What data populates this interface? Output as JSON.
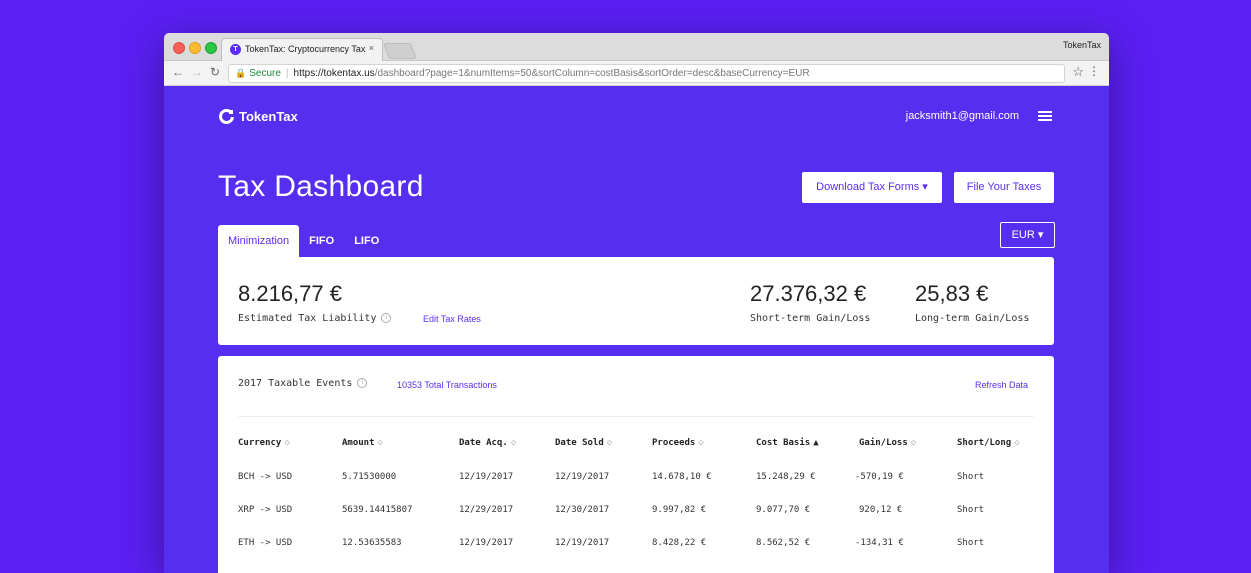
{
  "browser": {
    "tab_title": "TokenTax: Cryptocurrency Tax",
    "tab_close": "×",
    "profile": "TokenTax",
    "secure_label": "Secure",
    "url_host": "https://tokentax.us",
    "url_rest": "/dashboard?page=1&numItems=50&sortColumn=costBasis&sortOrder=desc&baseCurrency=EUR"
  },
  "header": {
    "logo_text": "TokenTax",
    "user_email": "jacksmith1@gmail.com"
  },
  "page": {
    "title": "Tax Dashboard",
    "download_label": "Download Tax Forms ▾",
    "file_label": "File Your Taxes",
    "tabs": [
      "Minimization",
      "FIFO",
      "LIFO"
    ],
    "currency": "EUR ▾"
  },
  "summary": {
    "liability_value": "8.216,77 €",
    "liability_label": "Estimated Tax Liability",
    "edit_rates": "Edit Tax Rates",
    "short_value": "27.376,32 €",
    "short_label": "Short-term Gain/Loss",
    "long_value": "25,83 €",
    "long_label": "Long-term Gain/Loss"
  },
  "events": {
    "title": "2017 Taxable Events",
    "total": "10353 Total Transactions",
    "refresh": "Refresh Data",
    "columns": [
      "Currency",
      "Amount",
      "Date Acq.",
      "Date Sold",
      "Proceeds",
      "Cost Basis",
      "Gain/Loss",
      "Short/Long"
    ],
    "rows": [
      [
        "BCH -> USD",
        "5.71530000",
        "12/19/2017",
        "12/19/2017",
        "14.678,10 €",
        "15.248,29 €",
        "-570,19 €",
        "Short"
      ],
      [
        "XRP -> USD",
        "5639.14415807",
        "12/29/2017",
        "12/30/2017",
        "9.997,82 €",
        "9.077,70 €",
        "920,12 €",
        "Short"
      ],
      [
        "ETH -> USD",
        "12.53635583",
        "12/19/2017",
        "12/19/2017",
        "8.428,22 €",
        "8.562,52 €",
        "-134,31 €",
        "Short"
      ]
    ]
  },
  "colors": {
    "brand": "#562ef0",
    "background": "#5b1ff2"
  }
}
